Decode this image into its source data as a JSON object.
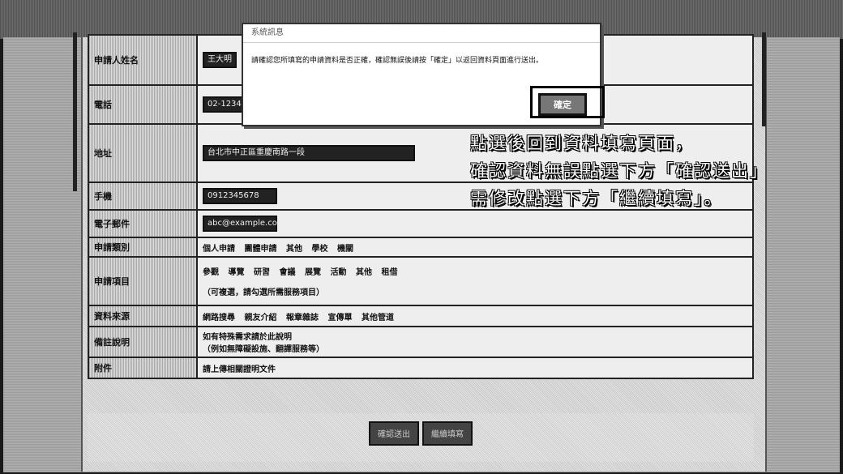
{
  "form": {
    "rows": [
      {
        "label": "申請人姓名",
        "value": "王大明"
      },
      {
        "label": "電話",
        "value": "02-1234-5678"
      },
      {
        "label": "地址",
        "value": "台北市中正區重慶南路一段"
      },
      {
        "label": "手機",
        "value": "0912345678"
      },
      {
        "label": "電子郵件",
        "value": "abc@example.com"
      },
      {
        "label": "申請類別",
        "options": [
          "個人申請",
          "團體申請",
          "其他",
          "學校",
          "機關"
        ]
      },
      {
        "label": "申請項目",
        "options": [
          "參觀",
          "導覽",
          "研習",
          "會議",
          "展覽",
          "活動",
          "其他",
          "租借"
        ],
        "note": "（可複選，請勾選所需服務項目）"
      },
      {
        "label": "資料來源",
        "options": [
          "網路搜尋",
          "親友介紹",
          "報章雜誌",
          "宣傳單",
          "其他管道"
        ]
      },
      {
        "label": "備註說明",
        "value": "如有特殊需求請於此說明",
        "value2": "（例如無障礙設施、翻譯服務等）"
      },
      {
        "label": "附件",
        "value": "請上傳相關證明文件"
      }
    ]
  },
  "buttons": {
    "confirm": "確認送出",
    "continue": "繼續填寫"
  },
  "dialog": {
    "title": "系統訊息",
    "message": "請確認您所填寫的申請資料是否正確，確認無誤後請按「確定」以返回資料頁面進行送出。",
    "ok": "確定"
  },
  "annotation": {
    "line1": "點選後回到資料填寫頁面，",
    "line2": "確認資料無誤點選下方「確認送出」",
    "line3": "需修改點選下方「繼續填寫」。"
  }
}
